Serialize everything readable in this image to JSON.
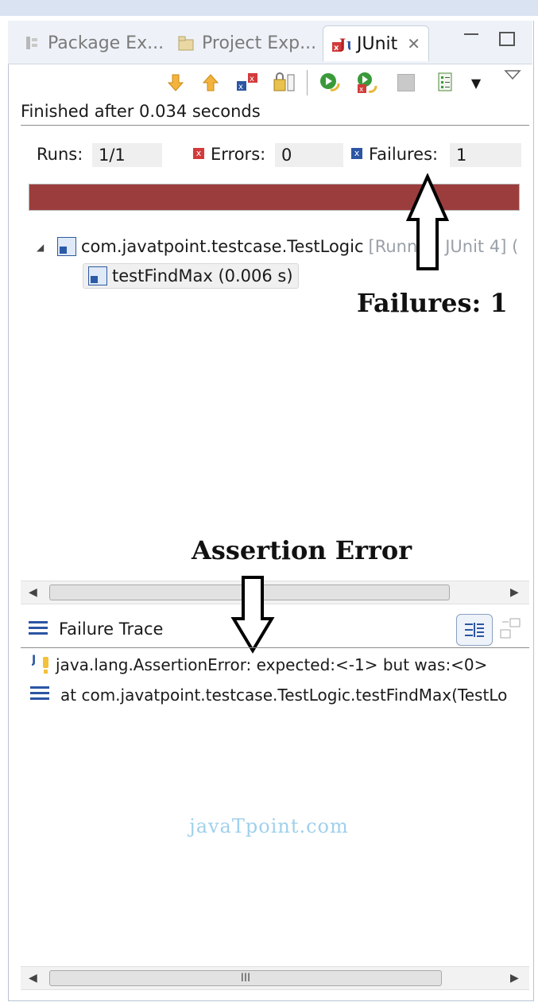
{
  "tabs": [
    {
      "label": "Package Ex...",
      "icon": "package-explorer-icon"
    },
    {
      "label": "Project Exp...",
      "icon": "project-explorer-icon"
    },
    {
      "label": "JUnit",
      "icon": "junit-icon",
      "active": true
    }
  ],
  "toolbar": {
    "icons": [
      "next-failure-icon",
      "previous-failure-icon",
      "show-failures-only-icon",
      "scroll-lock-icon",
      "rerun-test-icon",
      "rerun-failed-first-icon",
      "stop-icon",
      "test-run-history-icon",
      "dropdown-icon",
      "view-menu-icon"
    ]
  },
  "status": {
    "finished": "Finished after 0.034 seconds"
  },
  "counters": {
    "runs_label": "Runs:",
    "runs_value": "1/1",
    "errors_label": "Errors:",
    "errors_value": "0",
    "failures_label": "Failures:",
    "failures_value": "1"
  },
  "progress": {
    "fraction": 1.0,
    "color": "#9c3d3d"
  },
  "tree": {
    "suite_name": "com.javatpoint.testcase.TestLogic",
    "suite_runner": "[Runner: JUnit 4] (",
    "test_name": "testFindMax (0.006 s)"
  },
  "annotations": {
    "failures": "Failures: 1",
    "assertion": "Assertion Error"
  },
  "scroll": {
    "thumb_label": "III"
  },
  "trace": {
    "title": "Failure Trace",
    "lines": [
      "java.lang.AssertionError: expected:<-1> but was:<0>",
      "at com.javatpoint.testcase.TestLogic.testFindMax(TestLo"
    ]
  },
  "watermark": "javaTpoint.com"
}
